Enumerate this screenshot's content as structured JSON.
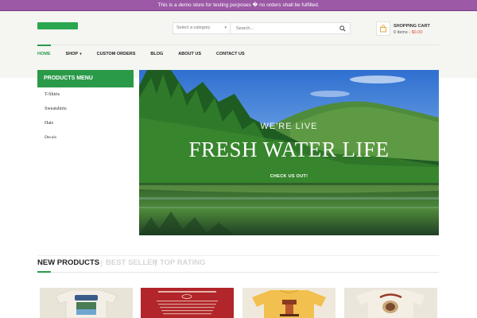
{
  "notice": "This is a demo store for testing purposes � no orders shall be fulfilled.",
  "search": {
    "category_placeholder": "Select a category",
    "placeholder": "Search..."
  },
  "cart": {
    "title": "SHOPPING CART",
    "items": "0 items - ",
    "total": "$0.00"
  },
  "nav": [
    {
      "label": "HOME",
      "active": true
    },
    {
      "label": "SHOP",
      "has_dropdown": true
    },
    {
      "label": "CUSTOM ORDERS"
    },
    {
      "label": "BLOG"
    },
    {
      "label": "ABOUT US"
    },
    {
      "label": "CONTACT US"
    }
  ],
  "sidebar": {
    "title": "PRODUCTS MENU",
    "items": [
      "T-Shirts",
      "Sweatshirts",
      "Hats",
      "Decals"
    ]
  },
  "banner": {
    "subtitle": "WE'RE LIVE",
    "title": "FRESH WATER LIFE",
    "cta": "CHECK US OUT!"
  },
  "product_tabs": [
    {
      "label": "NEW PRODUCTS",
      "active": true
    },
    {
      "label": "BEST SELLER",
      "active": false
    },
    {
      "label": "TOP RATING",
      "active": false
    }
  ],
  "colors": {
    "accent": "#2a9a49",
    "notice_bg": "#9b59a6",
    "price": "#d84b3a"
  },
  "icons": {
    "search": "search-icon",
    "cart": "shopping-bag-icon",
    "dropdown": "chevron-down-icon"
  }
}
